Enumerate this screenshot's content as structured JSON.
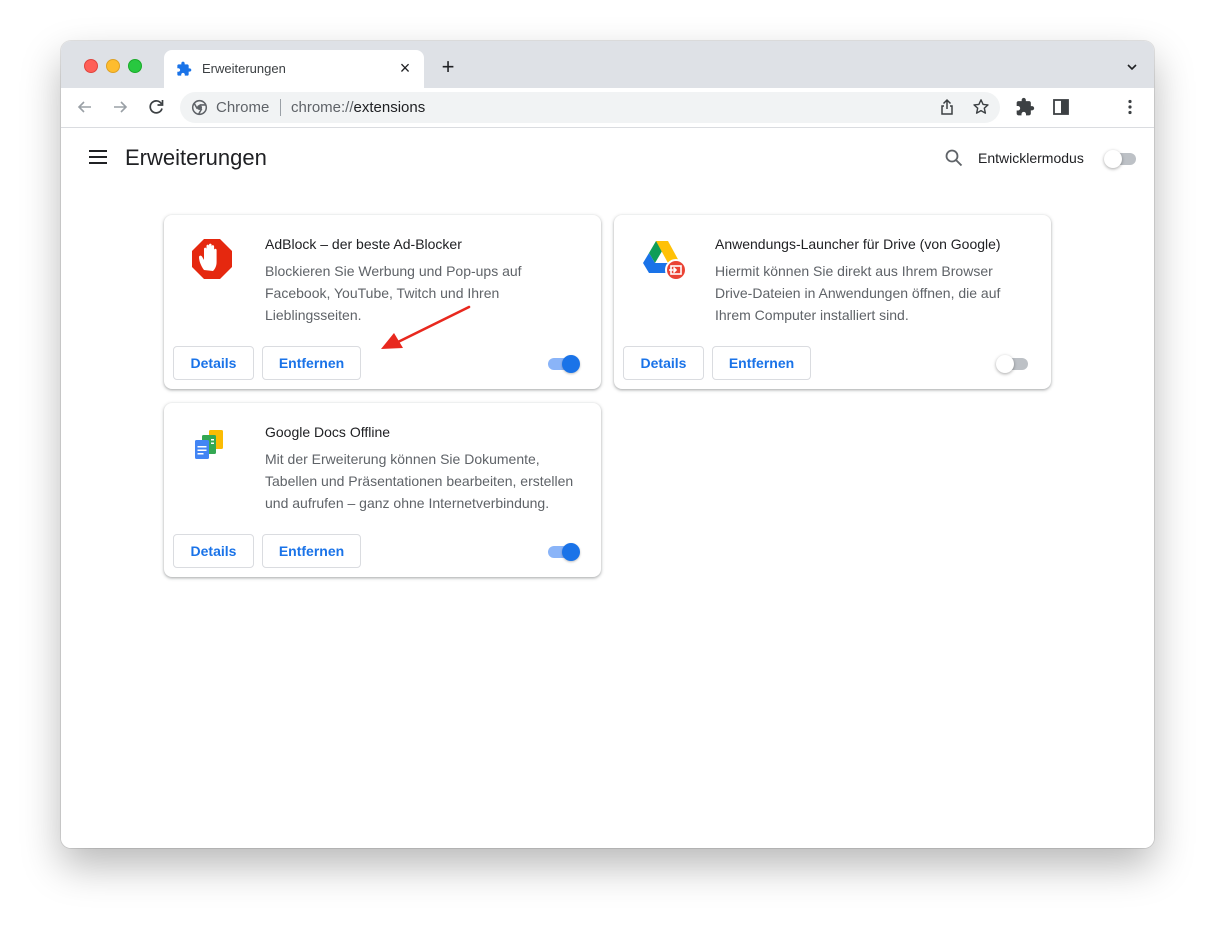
{
  "browser": {
    "tab_title": "Erweiterungen",
    "omnibox_prefix": "Chrome",
    "url_scheme": "chrome://",
    "url_path": "extensions"
  },
  "page": {
    "title": "Erweiterungen",
    "developer_mode_label": "Entwicklermodus",
    "developer_mode_enabled": false
  },
  "extensions": [
    {
      "name": "AdBlock – der beste Ad-Blocker",
      "description": "Blockieren Sie Werbung und Pop-ups auf Facebook, YouTube, Twitch und Ihren Lieblingsseiten.",
      "details_label": "Details",
      "remove_label": "Entfernen",
      "enabled": true,
      "icon": "adblock-hand-icon"
    },
    {
      "name": "Anwendungs-Launcher für Drive (von Google)",
      "description": "Hiermit können Sie direkt aus Ihrem Browser Drive-Dateien in Anwendungen öffnen, die auf Ihrem Computer installiert sind.",
      "details_label": "Details",
      "remove_label": "Entfernen",
      "enabled": false,
      "icon": "google-drive-launcher-icon"
    },
    {
      "name": "Google Docs Offline",
      "description": "Mit der Erweiterung können Sie Dokumente, Tabellen und Präsentationen bearbeiten, erstellen und aufrufen – ganz ohne Internetverbindung.",
      "details_label": "Details",
      "remove_label": "Entfernen",
      "enabled": true,
      "icon": "google-docs-offline-icon"
    }
  ],
  "colors": {
    "accent": "#1a73e8",
    "toggle_on_track": "#8ab4f8",
    "annotation_arrow": "#e8281e"
  }
}
